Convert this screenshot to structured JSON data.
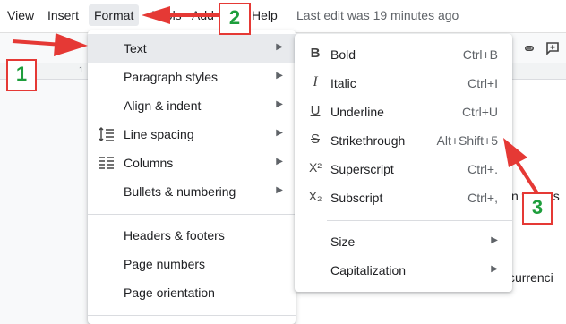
{
  "menubar": {
    "items": [
      "View",
      "Insert",
      "Format",
      "Tools",
      "Add-ons",
      "Help"
    ],
    "last_edit": "Last edit was 19 minutes ago"
  },
  "ruler": {
    "mark": "1"
  },
  "document": {
    "frag1": "n factors",
    "frag2": "ccurrenci"
  },
  "format_menu": {
    "items": [
      {
        "label": "Text"
      },
      {
        "label": "Paragraph styles"
      },
      {
        "label": "Align & indent"
      },
      {
        "label": "Line spacing"
      },
      {
        "label": "Columns"
      },
      {
        "label": "Bullets & numbering"
      },
      {
        "label": "Headers & footers"
      },
      {
        "label": "Page numbers"
      },
      {
        "label": "Page orientation"
      }
    ]
  },
  "text_submenu": {
    "items": [
      {
        "label": "Bold",
        "shortcut": "Ctrl+B",
        "icon": "B"
      },
      {
        "label": "Italic",
        "shortcut": "Ctrl+I",
        "icon": "I"
      },
      {
        "label": "Underline",
        "shortcut": "Ctrl+U",
        "icon": "U"
      },
      {
        "label": "Strikethrough",
        "shortcut": "Alt+Shift+5",
        "icon": "S"
      },
      {
        "label": "Superscript",
        "shortcut": "Ctrl+.",
        "icon": "X²"
      },
      {
        "label": "Subscript",
        "shortcut": "Ctrl+,",
        "icon": "X₂"
      },
      {
        "label": "Size"
      },
      {
        "label": "Capitalization"
      }
    ]
  },
  "callouts": {
    "one": "1",
    "two": "2",
    "three": "3"
  },
  "colors": {
    "arrow": "#e53935",
    "callout_text": "#1e9e3c",
    "highlight": "#e8eaed"
  }
}
